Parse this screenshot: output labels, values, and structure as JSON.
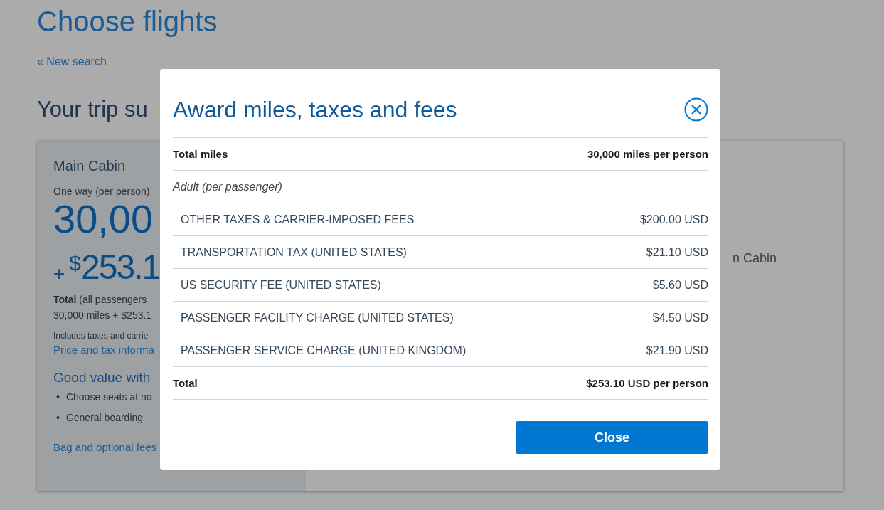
{
  "page": {
    "title": "Choose flights",
    "new_search_link": "« New search",
    "section_title": "Your trip su"
  },
  "fare_card": {
    "cabin": "Main Cabin",
    "trip_type": "One way (per person)",
    "miles": "30,00",
    "price_prefix": "+",
    "currency": "$",
    "price": "253.1",
    "total_label": "**Total** (all passengers",
    "total_value": "30,000 miles + $253.1",
    "includes_note": "Includes taxes and carrie",
    "price_link": "Price and tax informa",
    "benefits_title": "Good value with",
    "benefits": [
      {
        "marker": "•",
        "text": "Choose seats at no"
      },
      {
        "marker": "•",
        "text": "General boarding"
      }
    ],
    "fees_link": "Bag and optional fees"
  },
  "other_fare": {
    "cabin": "n Cabin"
  },
  "dialog": {
    "title": "Award miles, taxes and fees",
    "rows": [
      {
        "kind": "summary",
        "label": "Total miles",
        "value": "30,000 miles per person"
      },
      {
        "kind": "group",
        "label": "Adult (per passenger)"
      },
      {
        "kind": "item",
        "label": "OTHER TAXES & CARRIER-IMPOSED FEES",
        "value": "$200.00 USD"
      },
      {
        "kind": "item",
        "label": "TRANSPORTATION TAX (UNITED STATES)",
        "value": "$21.10 USD"
      },
      {
        "kind": "item",
        "label": "US SECURITY FEE (UNITED STATES)",
        "value": "$5.60 USD"
      },
      {
        "kind": "item",
        "label": "PASSENGER FACILITY CHARGE (UNITED STATES)",
        "value": "$4.50 USD"
      },
      {
        "kind": "item",
        "label": "PASSENGER SERVICE CHARGE (UNITED KINGDOM)",
        "value": "$21.90 USD"
      },
      {
        "kind": "summary",
        "label": "Total",
        "value": "$253.10 USD per person"
      }
    ],
    "close_button": "Close"
  }
}
